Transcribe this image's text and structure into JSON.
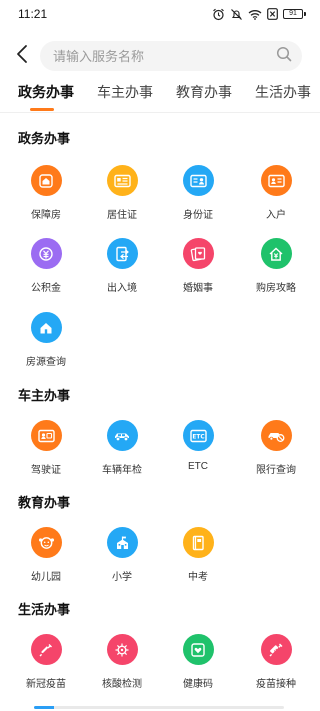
{
  "status_bar": {
    "time": "11:21",
    "battery": "91"
  },
  "search": {
    "placeholder": "请输入服务名称"
  },
  "tabs": [
    {
      "label": "政务办事",
      "active": true
    },
    {
      "label": "车主办事",
      "active": false
    },
    {
      "label": "教育办事",
      "active": false
    },
    {
      "label": "生活办事",
      "active": false
    }
  ],
  "sections": [
    {
      "title": "政务办事",
      "items": [
        {
          "label": "保障房",
          "icon": "house-shield-icon",
          "color": "#ff7a1a"
        },
        {
          "label": "居住证",
          "icon": "residence-card-icon",
          "color": "#ffb21a"
        },
        {
          "label": "身份证",
          "icon": "id-card-icon",
          "color": "#24a8f5"
        },
        {
          "label": "入户",
          "icon": "household-register-icon",
          "color": "#ff7a1a"
        },
        {
          "label": "公积金",
          "icon": "housing-fund-icon",
          "color": "#9b6cf2"
        },
        {
          "label": "出入境",
          "icon": "exit-entry-icon",
          "color": "#24a8f5"
        },
        {
          "label": "婚姻事",
          "icon": "marriage-icon",
          "color": "#f5456a"
        },
        {
          "label": "购房攻略",
          "icon": "house-purchase-icon",
          "color": "#1fc26b"
        },
        {
          "label": "房源查询",
          "icon": "house-search-icon",
          "color": "#24a8f5"
        }
      ]
    },
    {
      "title": "车主办事",
      "items": [
        {
          "label": "驾驶证",
          "icon": "driver-license-icon",
          "color": "#ff7a1a"
        },
        {
          "label": "车辆年检",
          "icon": "vehicle-inspection-icon",
          "color": "#24a8f5"
        },
        {
          "label": "ETC",
          "icon": "etc-icon",
          "color": "#24a8f5"
        },
        {
          "label": "限行查询",
          "icon": "traffic-restriction-icon",
          "color": "#ff7a1a"
        }
      ]
    },
    {
      "title": "教育办事",
      "items": [
        {
          "label": "幼儿园",
          "icon": "kindergarten-icon",
          "color": "#ff7a1a"
        },
        {
          "label": "小学",
          "icon": "primary-school-icon",
          "color": "#24a8f5"
        },
        {
          "label": "中考",
          "icon": "exam-book-icon",
          "color": "#ffb21a"
        }
      ]
    },
    {
      "title": "生活办事",
      "items": [
        {
          "label": "新冠疫苗",
          "icon": "covid-vaccine-icon",
          "color": "#f5456a"
        },
        {
          "label": "核酸检测",
          "icon": "nucleic-acid-test-icon",
          "color": "#f5456a"
        },
        {
          "label": "健康码",
          "icon": "health-code-icon",
          "color": "#1fc26b"
        },
        {
          "label": "疫苗接种",
          "icon": "vaccination-icon",
          "color": "#f5456a"
        }
      ]
    }
  ]
}
